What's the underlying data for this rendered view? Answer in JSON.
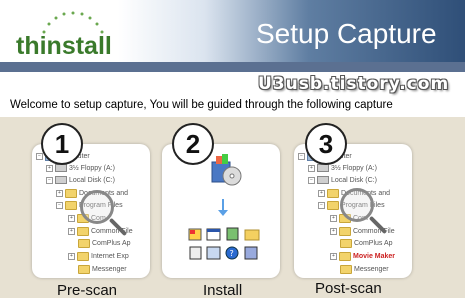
{
  "banner": {
    "logo_text": "thinstall",
    "title": "Setup Capture",
    "logo_color": "#3a7a2b"
  },
  "watermark": "U3usb.tistory.com",
  "welcome_text": "Welcome to setup capture,  You will be guided through the following capture",
  "steps": [
    {
      "number": "1",
      "label": "Pre-scan",
      "tree": [
        "Computer",
        "3½ Floppy (A:)",
        "Local Disk (C:)",
        "Documents and",
        "Program Files",
        "Com",
        "Common File",
        "ComPlus Ap",
        "Internet Exp",
        "Messenger"
      ]
    },
    {
      "number": "2",
      "label": "Install"
    },
    {
      "number": "3",
      "label": "Post-scan",
      "tree": [
        "Computer",
        "3½ Floppy (A:)",
        "Local Disk (C:)",
        "Documents and",
        "Program Files",
        "Com",
        "Common File",
        "ComPlus Ap",
        "Movie Maker",
        "Messenger"
      ]
    }
  ],
  "colors": {
    "panel_bg": "#e7e1d2",
    "banner_dark": "#2f4f78",
    "highlight_red": "#c22222"
  }
}
